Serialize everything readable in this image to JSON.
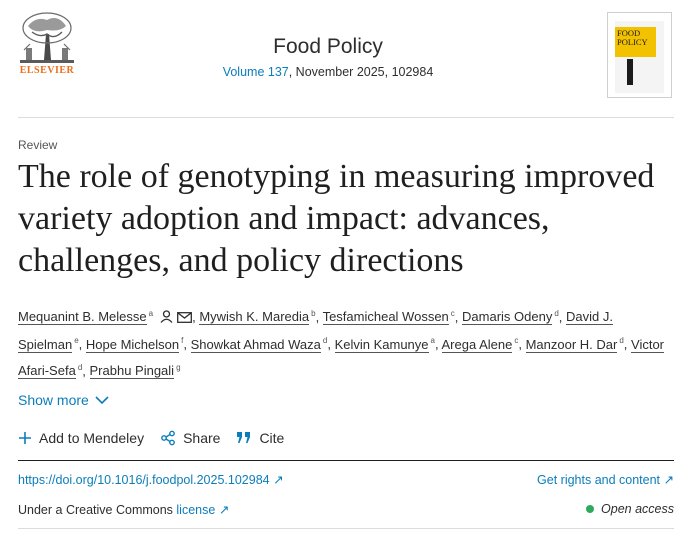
{
  "publisher": {
    "name": "ELSEVIER"
  },
  "journal": {
    "title": "Food Policy",
    "volume_link": "Volume 137",
    "issue_rest": ", November 2025, 102984"
  },
  "cover": {
    "title_line1": "FOOD",
    "title_line2": "POLICY"
  },
  "article": {
    "type": "Review",
    "title": "The role of genotyping in measuring improved variety adoption and impact: advances, challenges, and policy directions"
  },
  "authors": [
    {
      "name": "Mequanint B. Melesse",
      "aff": "a",
      "icons": true
    },
    {
      "name": "Mywish K. Maredia",
      "aff": "b"
    },
    {
      "name": "Tesfamicheal Wossen",
      "aff": "c"
    },
    {
      "name": "Damaris Odeny",
      "aff": "d"
    },
    {
      "name": "David J. Spielman",
      "aff": "e"
    },
    {
      "name": "Hope Michelson",
      "aff": "f"
    },
    {
      "name": "Showkat Ahmad Waza",
      "aff": "d"
    },
    {
      "name": "Kelvin Kamunye",
      "aff": "a"
    },
    {
      "name": "Arega Alene",
      "aff": "c"
    },
    {
      "name": "Manzoor H. Dar",
      "aff": "d"
    },
    {
      "name": "Victor Afari-Sefa",
      "aff": "d"
    },
    {
      "name": "Prabhu Pingali",
      "aff": "g"
    }
  ],
  "show_more": "Show more",
  "actions": {
    "mendeley": "Add to Mendeley",
    "share": "Share",
    "cite": "Cite"
  },
  "links": {
    "doi": "https://doi.org/10.1016/j.foodpol.2025.102984",
    "rights": "Get rights and content",
    "license_prefix": "Under a Creative Commons",
    "license": "license",
    "open_access": "Open access"
  },
  "colors": {
    "link": "#0c7dbb",
    "publisher": "#e9711c",
    "cover_accent": "#f2c200",
    "open_access_dot": "#2eaa5a"
  }
}
